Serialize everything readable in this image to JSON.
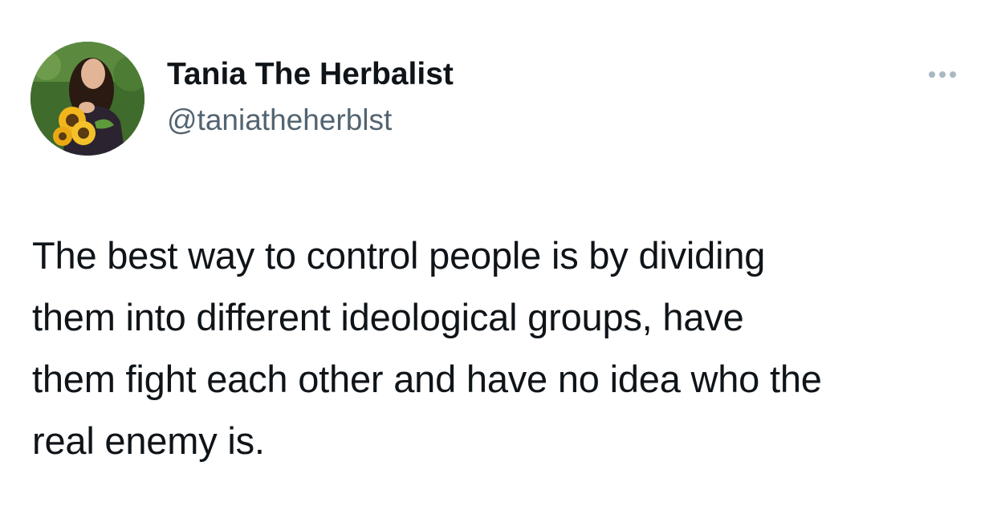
{
  "tweet": {
    "author": {
      "display_name": "Tania The Herbalist",
      "handle": "@taniatheherblst",
      "avatar": "avatar-photo-woman-with-sunflowers"
    },
    "more_icon": "more-horizontal-icon",
    "text": "The best way to control people is by dividing\nthem into different ideological groups, have\nthem fight each other and have no idea who the\nreal enemy is."
  },
  "colors": {
    "text_primary": "#0f1419",
    "text_secondary": "#536471",
    "icon_muted": "#aab8c2",
    "background": "#ffffff"
  }
}
